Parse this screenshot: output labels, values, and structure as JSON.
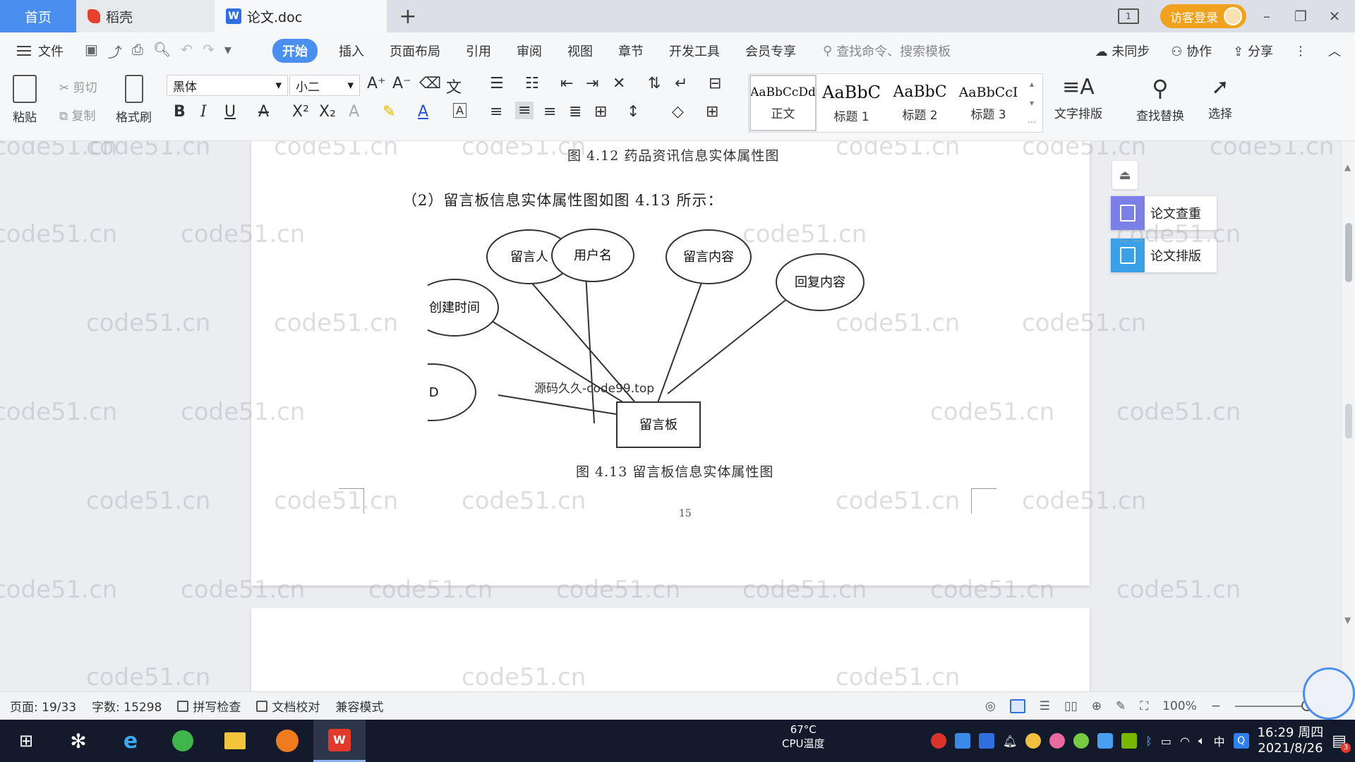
{
  "tabs": {
    "home": "首页",
    "daoke": "稻壳",
    "doc": "论文.doc",
    "add": "+"
  },
  "title_right": {
    "reader_icon": "1",
    "login": "访客登录"
  },
  "menu": {
    "file": "文件",
    "items": [
      "开始",
      "插入",
      "页面布局",
      "引用",
      "审阅",
      "视图",
      "章节",
      "开发工具",
      "会员专享"
    ],
    "search_placeholder": "查找命令、搜索模板",
    "unsynced": "未同步",
    "collab": "协作",
    "share": "分享"
  },
  "toolbar": {
    "paste": "粘贴",
    "cut": "剪切",
    "copy": "复制",
    "format_painter": "格式刷",
    "font_name": "黑体",
    "font_size": "小二",
    "styles": [
      {
        "sample": "AaBbCcDd",
        "name": "正文"
      },
      {
        "sample": "AaBbC",
        "name": "标题 1"
      },
      {
        "sample": "AaBbC",
        "name": "标题 2"
      },
      {
        "sample": "AaBbCcI",
        "name": "标题 3"
      }
    ],
    "text_layout": "文字排版",
    "find_replace": "查找替换",
    "select": "选择"
  },
  "document": {
    "caption_top": "图 4.12   药品资讯信息实体属性图",
    "paragraph": "（2）留言板信息实体属性图如图 4.13 所示：",
    "caption_bottom": "图 4.13   留言板信息实体属性图",
    "page_number": "15",
    "diagram_watermark": "源码久久-code99.top",
    "entity": "留言板",
    "attributes": [
      "ID",
      "创建时间",
      "留言人",
      "用户名",
      "留言内容",
      "回复内容"
    ]
  },
  "side_panel": {
    "check": "论文查重",
    "layout": "论文排版"
  },
  "watermark": "code51.cn",
  "status": {
    "page": "页面: 19/33",
    "words": "字数: 15298",
    "spell": "拼写检查",
    "proof": "文档校对",
    "compat": "兼容模式",
    "zoom": "100%"
  },
  "taskbar": {
    "cpu_temp": "67°C",
    "cpu_label": "CPU温度",
    "time": "16:29 周四",
    "date": "2021/8/26",
    "ime": "中",
    "notif_count": "3"
  }
}
